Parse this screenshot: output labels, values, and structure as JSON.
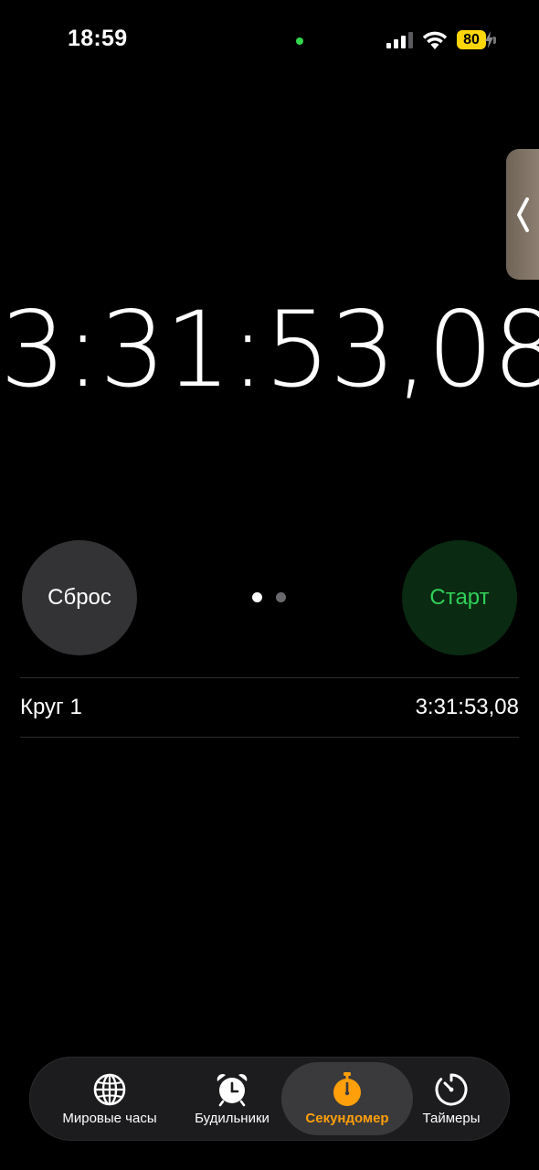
{
  "status_bar": {
    "time": "18:59",
    "battery": "80",
    "mic_color": "#32d74b",
    "battery_color": "#ffd60a"
  },
  "stopwatch": {
    "elapsed": "3:31:53,08",
    "reset_label": "Сброс",
    "start_label": "Старт",
    "start_color": "#30d158",
    "page_indicator": {
      "count": 2,
      "current": 1
    }
  },
  "laps": [
    {
      "label": "Круг 1",
      "time": "3:31:53,08"
    }
  ],
  "tab_bar": {
    "items": [
      {
        "label": "Мировые часы",
        "icon": "globe-icon",
        "active": false
      },
      {
        "label": "Будильники",
        "icon": "alarm-clock-icon",
        "active": false
      },
      {
        "label": "Секундомер",
        "icon": "stopwatch-icon",
        "active": true
      },
      {
        "label": "Таймеры",
        "icon": "timer-icon",
        "active": false
      }
    ],
    "active_color": "#ff9f0a"
  }
}
